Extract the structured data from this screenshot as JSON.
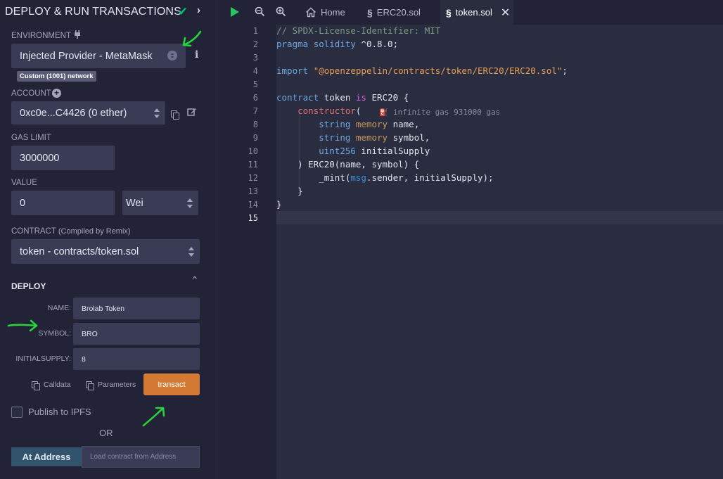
{
  "panel": {
    "title": "DEPLOY & RUN TRANSACTIONS",
    "environment_label": "ENVIRONMENT",
    "environment_value": "Injected Provider - MetaMask",
    "network_badge": "Custom (1001) network",
    "account_label": "ACCOUNT",
    "account_value": "0xc0e...C4426 (0 ether)",
    "gas_limit_label": "GAS LIMIT",
    "gas_limit_value": "3000000",
    "value_label": "VALUE",
    "value_amount": "0",
    "value_unit": "Wei",
    "contract_label": "CONTRACT",
    "contract_sub": "(Compiled by Remix)",
    "contract_value": "token - contracts/token.sol",
    "deploy_label": "DEPLOY",
    "params": [
      {
        "label": "NAME:",
        "value": "Brolab Token"
      },
      {
        "label": "SYMBOL:",
        "value": "BRO"
      },
      {
        "label": "INITIALSUPPLY:",
        "value": "8"
      }
    ],
    "calldata_label": "Calldata",
    "parameters_label": "Parameters",
    "transact_label": "transact",
    "publish_label": "Publish to IPFS",
    "or_label": "OR",
    "at_address_label": "At Address",
    "load_address_placeholder": "Load contract from Address"
  },
  "tabs": [
    {
      "label": "Home"
    },
    {
      "label": "ERC20.sol"
    },
    {
      "label": "token.sol"
    }
  ],
  "editor": {
    "line_numbers": [
      "1",
      "2",
      "3",
      "4",
      "5",
      "6",
      "7",
      "8",
      "9",
      "10",
      "11",
      "12",
      "13",
      "14",
      "15"
    ],
    "gas_hint": "infinite gas 931000 gas",
    "current_line": 15
  },
  "colors": {
    "accent": "#d47a34",
    "check": "#00c176",
    "annotation": "#27d33a"
  },
  "icons": [
    "check-icon",
    "chevron-right-icon",
    "plug-icon",
    "info-icon",
    "plus-circle-icon",
    "copy-icon",
    "edit-icon",
    "chevron-up-icon",
    "play-icon",
    "zoom-out-icon",
    "zoom-in-icon",
    "home-icon",
    "solidity-icon",
    "close-icon",
    "gas-pump-icon"
  ]
}
